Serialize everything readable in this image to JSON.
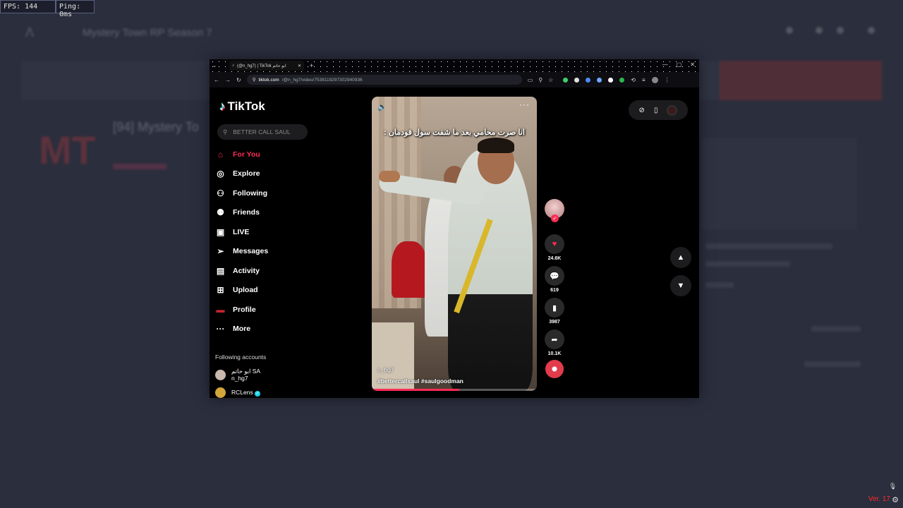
{
  "hud": {
    "fps": "FPS: 144",
    "ping": "Ping: 0ms"
  },
  "background": {
    "title": "Mystery Town RP Season 7",
    "logo_text": "MT",
    "server_name": "[94] Mystery To"
  },
  "browser": {
    "tab_title": "(@n_hg7) | TikTok ابو حاتم",
    "url_domain": "tiktok.com",
    "url_path": "/@n_hg7/video/7538119297302940936"
  },
  "tiktok": {
    "brand": "TikTok",
    "search_placeholder": "BETTER CALL SAUL",
    "nav": [
      {
        "label": "For You",
        "icon": "⌂"
      },
      {
        "label": "Explore",
        "icon": "◎"
      },
      {
        "label": "Following",
        "icon": "⚇"
      },
      {
        "label": "Friends",
        "icon": "⚉"
      },
      {
        "label": "LIVE",
        "icon": "▣"
      },
      {
        "label": "Messages",
        "icon": "➢"
      },
      {
        "label": "Activity",
        "icon": "▤"
      },
      {
        "label": "Upload",
        "icon": "⊞"
      },
      {
        "label": "Profile",
        "icon": "▬"
      },
      {
        "label": "More",
        "icon": "···"
      }
    ],
    "following_title": "Following accounts",
    "accounts": [
      {
        "display": "ابو حاتم SA",
        "handle": "n_hg7"
      },
      {
        "display": "RCLens",
        "handle": ""
      }
    ],
    "video": {
      "caption": "انا صرت محامي بعد ما شفت سول قودمان :",
      "author": "n_hg7",
      "tags": "#bettercallsaul #saulgoodman",
      "progress": 0.53
    },
    "actions": {
      "likes": "24.6K",
      "comments": "619",
      "saves": "3987",
      "shares": "10.1K"
    }
  },
  "footer": {
    "version": "Ver. 17"
  },
  "colors": {
    "accent": "#fe2c55",
    "page_bg": "#2b2e3d"
  }
}
